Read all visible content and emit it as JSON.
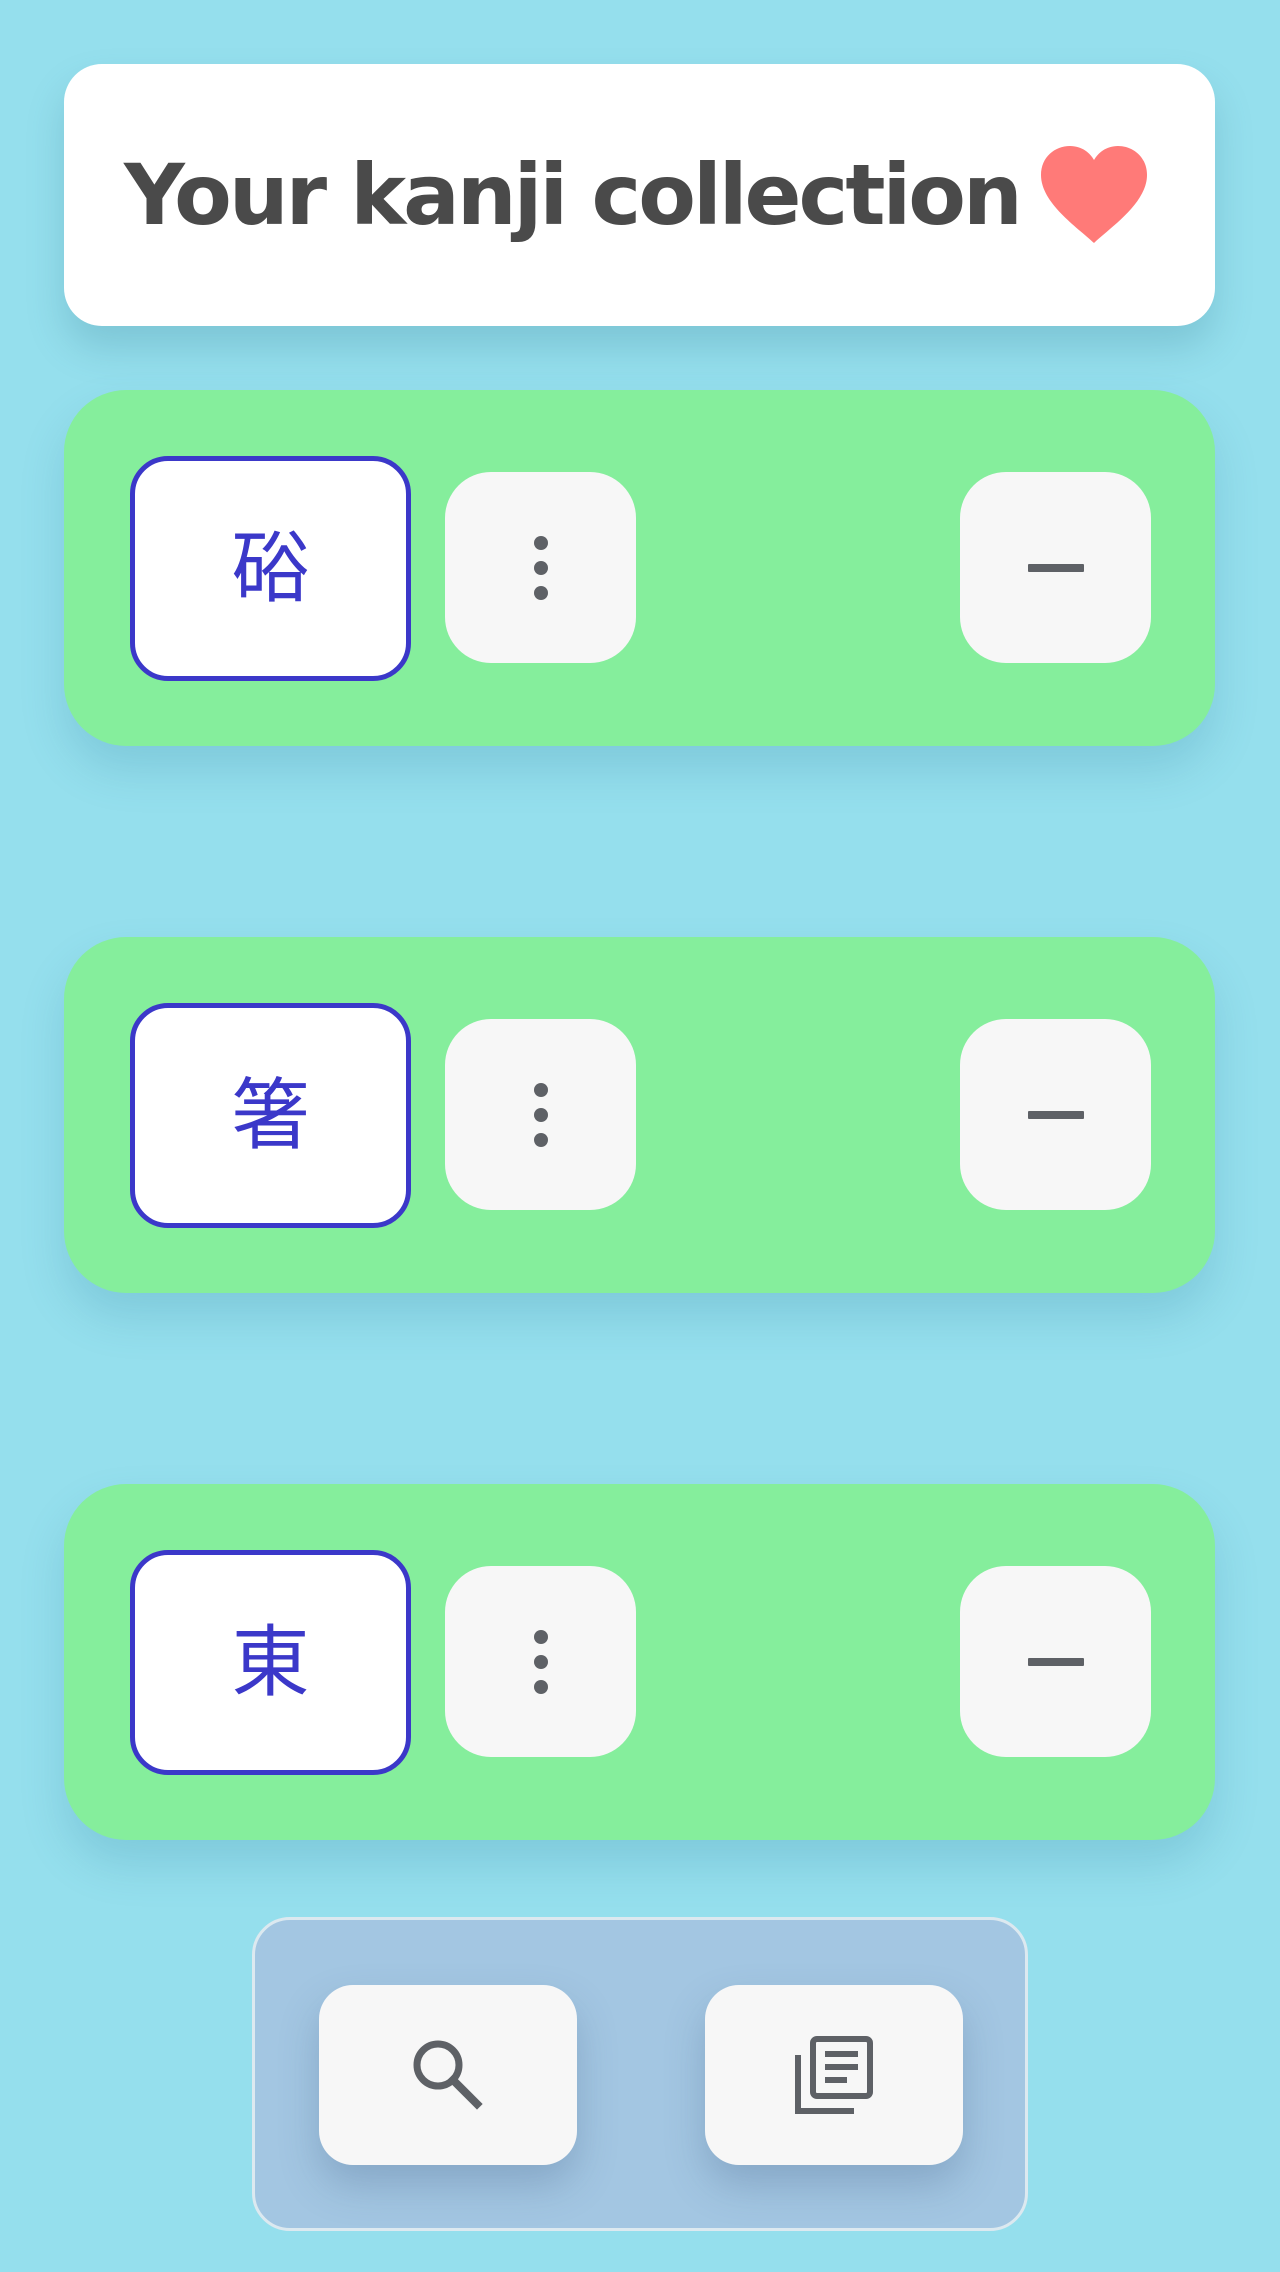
{
  "header": {
    "title": "Your kanji collection",
    "icon": "heart-icon",
    "icon_color": "#ff7a78"
  },
  "colors": {
    "background": "#95dfed",
    "row_background": "#85ee9c",
    "kanji_accent": "#3b38c9",
    "button_background": "#f7f7f7",
    "icon_gray": "#5e6166"
  },
  "kanji_list": [
    {
      "kanji": "硲",
      "more_icon": "more-vertical-icon",
      "remove_icon": "minus-icon"
    },
    {
      "kanji": "箸",
      "more_icon": "more-vertical-icon",
      "remove_icon": "minus-icon"
    },
    {
      "kanji": "東",
      "more_icon": "more-vertical-icon",
      "remove_icon": "minus-icon"
    }
  ],
  "bottom_nav": {
    "items": [
      {
        "icon": "search-icon"
      },
      {
        "icon": "library-books-icon"
      }
    ]
  }
}
